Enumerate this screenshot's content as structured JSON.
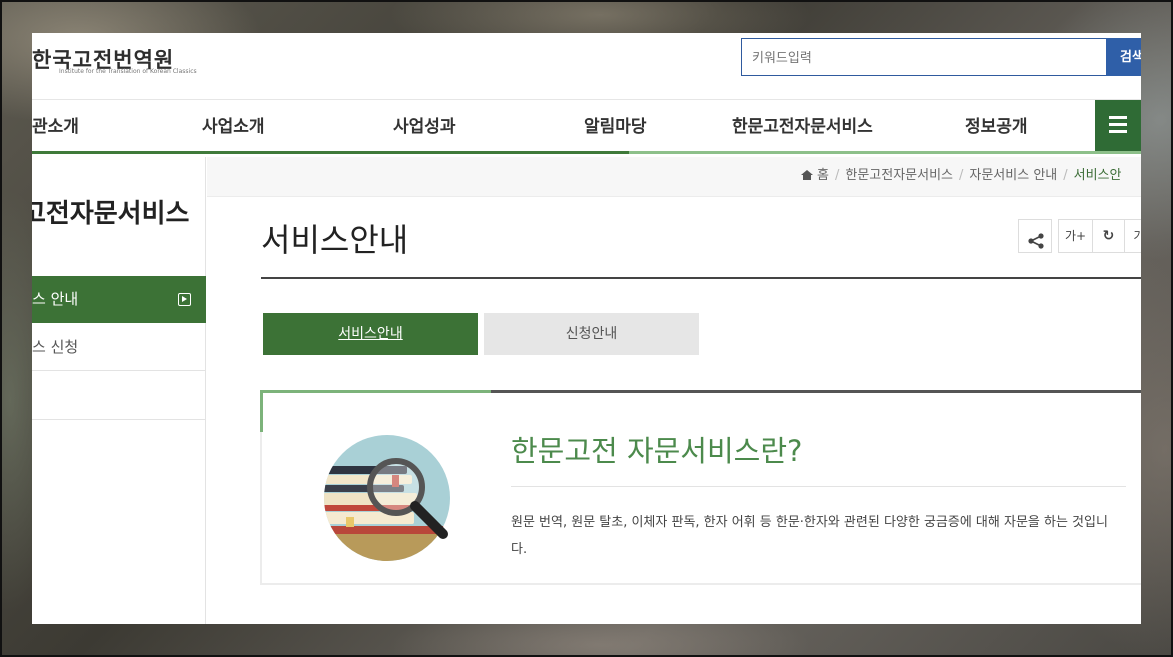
{
  "header": {
    "logo_title": "한국고전번역원",
    "logo_subtitle": "Institute for the Translation of Korean Classics",
    "search_placeholder": "키워드입력",
    "search_button": "검색"
  },
  "gnb": {
    "items": [
      "관소개",
      "사업소개",
      "사업성과",
      "알림마당",
      "한문고전자문서비스",
      "정보공개"
    ],
    "menu_icon": "hamburger-icon"
  },
  "sidebar": {
    "title": "고전자문서비스",
    "items": [
      {
        "label": "스 안내",
        "active": true
      },
      {
        "label": "스 신청",
        "active": false
      }
    ]
  },
  "breadcrumb": {
    "items": [
      "홈",
      "한문고전자문서비스",
      "자문서비스 안내",
      "서비스안"
    ]
  },
  "tools": {
    "share_icon": "share-icon",
    "font_up": "가+",
    "reset_icon": "refresh-icon",
    "font_down": "가"
  },
  "page": {
    "title": "서비스안내"
  },
  "tabs": [
    {
      "label": "서비스안내",
      "active": true
    },
    {
      "label": "신청안내",
      "active": false
    }
  ],
  "info": {
    "title": "한문고전 자문서비스란?",
    "description": "원문 번역, 원문 탈초, 이체자 판독, 한자 어휘 등 한문·한자와 관련된 다양한 궁금증에 대해 자문을 하는 것입니다.",
    "illustration_icon": "books-magnifier-icon"
  },
  "colors": {
    "primary_green": "#3c7236",
    "accent_green": "#8dc08a",
    "search_blue": "#2f5fa8",
    "title_green": "#4c8a4c"
  }
}
